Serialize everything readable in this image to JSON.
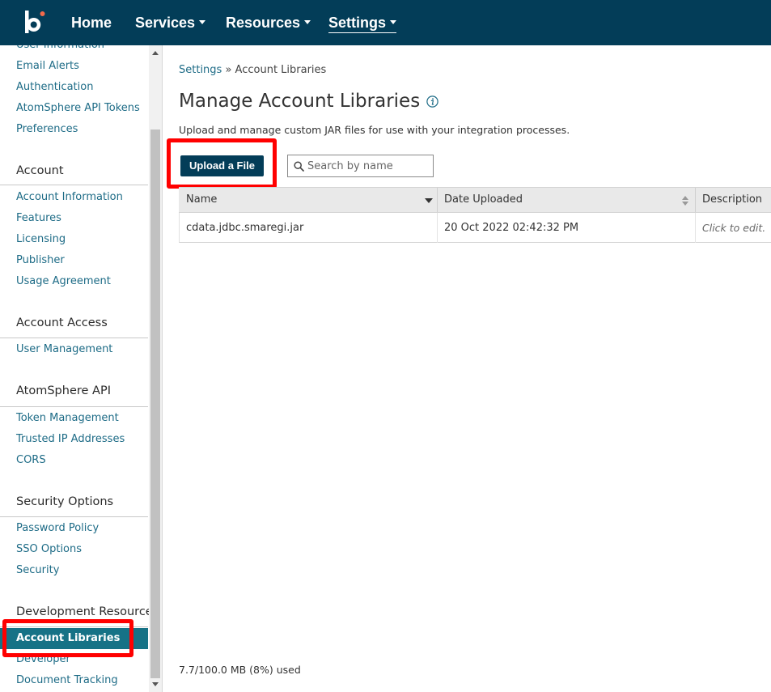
{
  "nav": {
    "home": "Home",
    "services": "Services",
    "resources": "Resources",
    "settings": "Settings"
  },
  "sidebar": {
    "user_info_partial": "User Information",
    "top_links": [
      "Email Alerts",
      "Authentication",
      "AtomSphere API Tokens",
      "Preferences"
    ],
    "sections": [
      {
        "heading": "Account",
        "items": [
          "Account Information",
          "Features",
          "Licensing",
          "Publisher",
          "Usage Agreement"
        ]
      },
      {
        "heading": "Account Access",
        "items": [
          "User Management"
        ]
      },
      {
        "heading": "AtomSphere API",
        "items": [
          "Token Management",
          "Trusted IP Addresses",
          "CORS"
        ]
      },
      {
        "heading": "Security Options",
        "items": [
          "Password Policy",
          "SSO Options",
          "Security"
        ]
      },
      {
        "heading": "Development Resources",
        "items": [
          "Account Libraries",
          "Developer",
          "Document Tracking"
        ]
      }
    ],
    "active_item": "Account Libraries"
  },
  "breadcrumb": {
    "parent": "Settings",
    "separator": " » ",
    "current": "Account Libraries"
  },
  "page": {
    "title": "Manage Account Libraries",
    "description": "Upload and manage custom JAR files for use with your integration processes.",
    "upload_button": "Upload a File",
    "search_placeholder": "Search by name"
  },
  "table": {
    "columns": [
      "Name",
      "Date Uploaded",
      "Description"
    ],
    "rows": [
      {
        "name": "cdata.jdbc.smaregi.jar",
        "date": "20 Oct 2022 02:42:32 PM",
        "description": "Click to edit."
      }
    ]
  },
  "usage": "7.7/100.0 MB (8%) used",
  "colors": {
    "topbar": "#033d58",
    "accent_link": "#1d6b86",
    "active_sidebar": "#167286",
    "logo_dot": "#f26a4b",
    "highlight": "#ff0000"
  },
  "icons": [
    "boomi-logo",
    "info-icon",
    "search-icon",
    "sort-down-icon",
    "sort-both-icon"
  ]
}
